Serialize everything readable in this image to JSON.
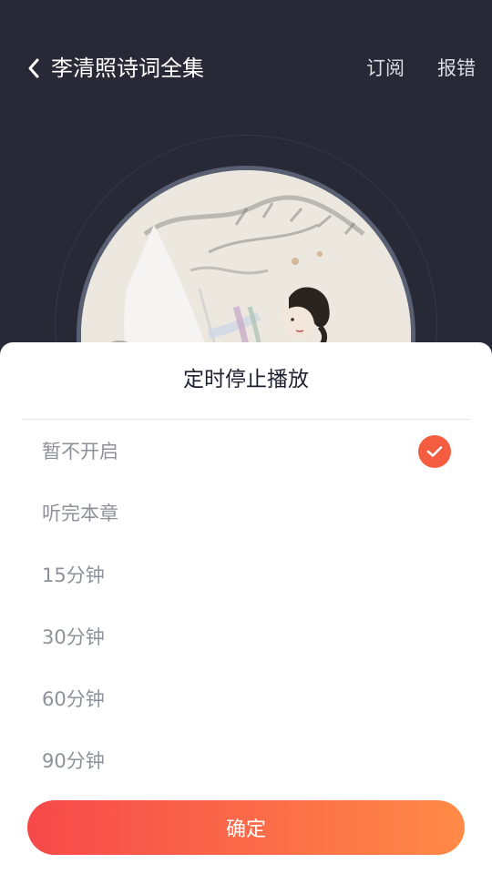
{
  "header": {
    "back_icon": "chevron-left-icon",
    "title": "李清照诗词全集",
    "subscribe_label": "订阅",
    "report_label": "报错"
  },
  "cover": {
    "description_icon": "album-cover-image"
  },
  "sheet": {
    "title": "定时停止播放",
    "options": [
      {
        "label": "暂不开启",
        "selected": true
      },
      {
        "label": "听完本章",
        "selected": false
      },
      {
        "label": "15分钟",
        "selected": false
      },
      {
        "label": "30分钟",
        "selected": false
      },
      {
        "label": "60分钟",
        "selected": false
      },
      {
        "label": "90分钟",
        "selected": false
      }
    ],
    "check_icon": "checkmark-icon",
    "confirm_label": "确定"
  },
  "colors": {
    "background": "#272a36",
    "accent": "#f45d3f",
    "button_gradient_start": "#f6494a",
    "button_gradient_end": "#ff8a47"
  }
}
